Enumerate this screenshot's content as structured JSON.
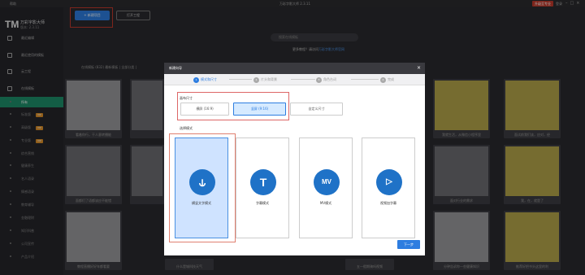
{
  "titlebar": {
    "menu": "帮助",
    "title": "万彩字影大师 2.3.11",
    "badge": "升级至专业",
    "user": "登录"
  },
  "app": {
    "logo": "TM",
    "name": "万彩字影大师",
    "version": "版本: 2.3.11"
  },
  "sidebar": {
    "items": [
      {
        "label": "最近编辑"
      },
      {
        "label": "最近使用的模板"
      },
      {
        "label": "云工程"
      },
      {
        "label": "在线模板"
      }
    ],
    "sub_items": [
      {
        "label": "所有",
        "tag": ""
      },
      {
        "label": "标准版",
        "tag": "VIP"
      },
      {
        "label": "高级版",
        "tag": "VIP"
      },
      {
        "label": "专业版",
        "tag": "VIP"
      },
      {
        "label": "综合营销",
        "tag": ""
      },
      {
        "label": "健康养生",
        "tag": ""
      },
      {
        "label": "名人语录",
        "tag": ""
      },
      {
        "label": "情感语录",
        "tag": ""
      },
      {
        "label": "教育辅导",
        "tag": ""
      },
      {
        "label": "金融理财",
        "tag": ""
      },
      {
        "label": "知识科普",
        "tag": ""
      },
      {
        "label": "公司宣传",
        "tag": ""
      },
      {
        "label": "产品介绍",
        "tag": ""
      }
    ]
  },
  "toolbar": {
    "new_project": "+ 新建项目",
    "open_project": "打开工程"
  },
  "search": {
    "placeholder": "搜索在线模板"
  },
  "tutorial": {
    "text": "更多教程？请访问",
    "link": "万彩字影大师官网"
  },
  "filter": {
    "text": "在线模板 (832)  最新模板  |  全部分类  |"
  },
  "cards": [
    {
      "caption": "看着你行，干人意转播能"
    },
    {
      "caption": ""
    },
    {
      "caption": "我就生活，从微信小程序里"
    },
    {
      "caption": "面试前我们该，应对，经"
    },
    {
      "caption": "面都们了语都该应不能错"
    },
    {
      "caption": ""
    },
    {
      "caption": "面对行业的需求"
    },
    {
      "caption": "我，在，就是了"
    },
    {
      "caption": "教程直播好好年都看要"
    },
    {
      "caption": "什么是城科技天气"
    },
    {
      "caption": "五一假期骑吗视频"
    },
    {
      "caption": "分钟告诉你一些健康知识"
    },
    {
      "caption": "推荐好把书头这里的利"
    }
  ],
  "dialog": {
    "title": "新建向导",
    "close": "×",
    "steps": [
      {
        "num": "1",
        "label": "模式和尺寸"
      },
      {
        "num": "2",
        "label": "片头和背景"
      },
      {
        "num": "3",
        "label": "角色台词"
      },
      {
        "num": "4",
        "label": "完成"
      }
    ],
    "size_label": "画布尺寸",
    "sizes": [
      {
        "label": "横屏 (16:9)"
      },
      {
        "label": "竖屏 (9:16)"
      },
      {
        "label": "自定义尺寸"
      }
    ],
    "mode_label": "选择模式",
    "modes": [
      {
        "icon": "⫝",
        "label": "横竖文字模式"
      },
      {
        "icon": "T",
        "label": "字幕模式"
      },
      {
        "icon": "MV",
        "label": "MV模式"
      },
      {
        "icon": "▷",
        "label": "视频加字幕"
      }
    ],
    "next": "下一步"
  },
  "colors": {
    "accent": "#2d7de0",
    "sidebar_active": "#1e8f6a",
    "highlight": "#d66"
  }
}
